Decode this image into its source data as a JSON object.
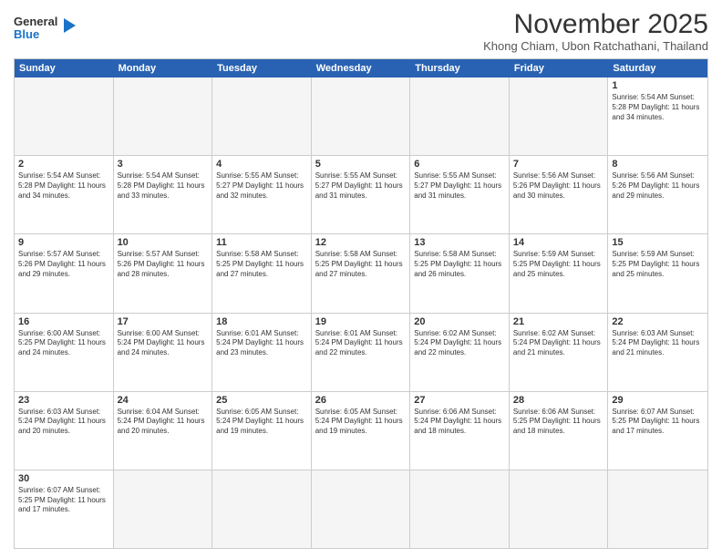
{
  "header": {
    "logo_general": "General",
    "logo_blue": "Blue",
    "month_title": "November 2025",
    "subtitle": "Khong Chiam, Ubon Ratchathani, Thailand"
  },
  "day_headers": [
    "Sunday",
    "Monday",
    "Tuesday",
    "Wednesday",
    "Thursday",
    "Friday",
    "Saturday"
  ],
  "rows": [
    [
      {
        "day": "",
        "empty": true,
        "content": ""
      },
      {
        "day": "",
        "empty": true,
        "content": ""
      },
      {
        "day": "",
        "empty": true,
        "content": ""
      },
      {
        "day": "",
        "empty": true,
        "content": ""
      },
      {
        "day": "",
        "empty": true,
        "content": ""
      },
      {
        "day": "",
        "empty": true,
        "content": ""
      },
      {
        "day": "1",
        "empty": false,
        "content": "Sunrise: 5:54 AM\nSunset: 5:28 PM\nDaylight: 11 hours\nand 34 minutes."
      }
    ],
    [
      {
        "day": "2",
        "empty": false,
        "content": "Sunrise: 5:54 AM\nSunset: 5:28 PM\nDaylight: 11 hours\nand 34 minutes."
      },
      {
        "day": "3",
        "empty": false,
        "content": "Sunrise: 5:54 AM\nSunset: 5:28 PM\nDaylight: 11 hours\nand 33 minutes."
      },
      {
        "day": "4",
        "empty": false,
        "content": "Sunrise: 5:55 AM\nSunset: 5:27 PM\nDaylight: 11 hours\nand 32 minutes."
      },
      {
        "day": "5",
        "empty": false,
        "content": "Sunrise: 5:55 AM\nSunset: 5:27 PM\nDaylight: 11 hours\nand 31 minutes."
      },
      {
        "day": "6",
        "empty": false,
        "content": "Sunrise: 5:55 AM\nSunset: 5:27 PM\nDaylight: 11 hours\nand 31 minutes."
      },
      {
        "day": "7",
        "empty": false,
        "content": "Sunrise: 5:56 AM\nSunset: 5:26 PM\nDaylight: 11 hours\nand 30 minutes."
      },
      {
        "day": "8",
        "empty": false,
        "content": "Sunrise: 5:56 AM\nSunset: 5:26 PM\nDaylight: 11 hours\nand 29 minutes."
      }
    ],
    [
      {
        "day": "9",
        "empty": false,
        "content": "Sunrise: 5:57 AM\nSunset: 5:26 PM\nDaylight: 11 hours\nand 29 minutes."
      },
      {
        "day": "10",
        "empty": false,
        "content": "Sunrise: 5:57 AM\nSunset: 5:26 PM\nDaylight: 11 hours\nand 28 minutes."
      },
      {
        "day": "11",
        "empty": false,
        "content": "Sunrise: 5:58 AM\nSunset: 5:25 PM\nDaylight: 11 hours\nand 27 minutes."
      },
      {
        "day": "12",
        "empty": false,
        "content": "Sunrise: 5:58 AM\nSunset: 5:25 PM\nDaylight: 11 hours\nand 27 minutes."
      },
      {
        "day": "13",
        "empty": false,
        "content": "Sunrise: 5:58 AM\nSunset: 5:25 PM\nDaylight: 11 hours\nand 26 minutes."
      },
      {
        "day": "14",
        "empty": false,
        "content": "Sunrise: 5:59 AM\nSunset: 5:25 PM\nDaylight: 11 hours\nand 25 minutes."
      },
      {
        "day": "15",
        "empty": false,
        "content": "Sunrise: 5:59 AM\nSunset: 5:25 PM\nDaylight: 11 hours\nand 25 minutes."
      }
    ],
    [
      {
        "day": "16",
        "empty": false,
        "content": "Sunrise: 6:00 AM\nSunset: 5:25 PM\nDaylight: 11 hours\nand 24 minutes."
      },
      {
        "day": "17",
        "empty": false,
        "content": "Sunrise: 6:00 AM\nSunset: 5:24 PM\nDaylight: 11 hours\nand 24 minutes."
      },
      {
        "day": "18",
        "empty": false,
        "content": "Sunrise: 6:01 AM\nSunset: 5:24 PM\nDaylight: 11 hours\nand 23 minutes."
      },
      {
        "day": "19",
        "empty": false,
        "content": "Sunrise: 6:01 AM\nSunset: 5:24 PM\nDaylight: 11 hours\nand 22 minutes."
      },
      {
        "day": "20",
        "empty": false,
        "content": "Sunrise: 6:02 AM\nSunset: 5:24 PM\nDaylight: 11 hours\nand 22 minutes."
      },
      {
        "day": "21",
        "empty": false,
        "content": "Sunrise: 6:02 AM\nSunset: 5:24 PM\nDaylight: 11 hours\nand 21 minutes."
      },
      {
        "day": "22",
        "empty": false,
        "content": "Sunrise: 6:03 AM\nSunset: 5:24 PM\nDaylight: 11 hours\nand 21 minutes."
      }
    ],
    [
      {
        "day": "23",
        "empty": false,
        "content": "Sunrise: 6:03 AM\nSunset: 5:24 PM\nDaylight: 11 hours\nand 20 minutes."
      },
      {
        "day": "24",
        "empty": false,
        "content": "Sunrise: 6:04 AM\nSunset: 5:24 PM\nDaylight: 11 hours\nand 20 minutes."
      },
      {
        "day": "25",
        "empty": false,
        "content": "Sunrise: 6:05 AM\nSunset: 5:24 PM\nDaylight: 11 hours\nand 19 minutes."
      },
      {
        "day": "26",
        "empty": false,
        "content": "Sunrise: 6:05 AM\nSunset: 5:24 PM\nDaylight: 11 hours\nand 19 minutes."
      },
      {
        "day": "27",
        "empty": false,
        "content": "Sunrise: 6:06 AM\nSunset: 5:24 PM\nDaylight: 11 hours\nand 18 minutes."
      },
      {
        "day": "28",
        "empty": false,
        "content": "Sunrise: 6:06 AM\nSunset: 5:25 PM\nDaylight: 11 hours\nand 18 minutes."
      },
      {
        "day": "29",
        "empty": false,
        "content": "Sunrise: 6:07 AM\nSunset: 5:25 PM\nDaylight: 11 hours\nand 17 minutes."
      }
    ],
    [
      {
        "day": "30",
        "empty": false,
        "content": "Sunrise: 6:07 AM\nSunset: 5:25 PM\nDaylight: 11 hours\nand 17 minutes."
      },
      {
        "day": "",
        "empty": true,
        "content": ""
      },
      {
        "day": "",
        "empty": true,
        "content": ""
      },
      {
        "day": "",
        "empty": true,
        "content": ""
      },
      {
        "day": "",
        "empty": true,
        "content": ""
      },
      {
        "day": "",
        "empty": true,
        "content": ""
      },
      {
        "day": "",
        "empty": true,
        "content": ""
      }
    ]
  ]
}
